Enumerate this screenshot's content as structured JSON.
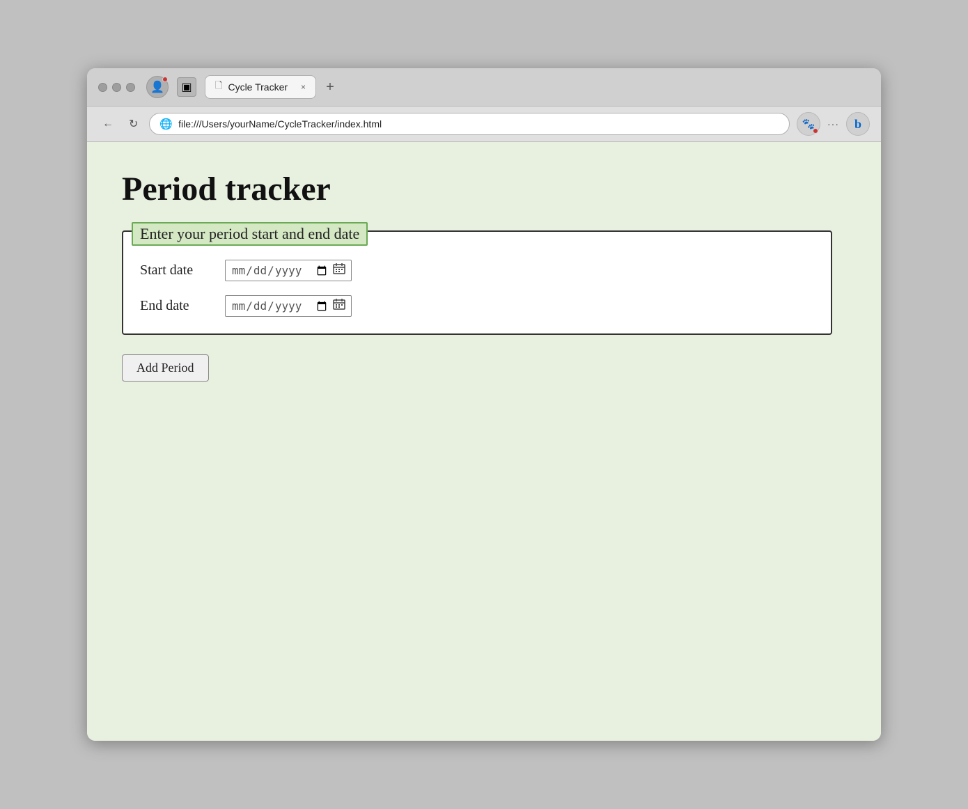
{
  "browser": {
    "tab_title": "Cycle Tracker",
    "tab_close_label": "×",
    "new_tab_label": "+",
    "address": "file:///Users/yourName/CycleTracker/index.html",
    "back_label": "←",
    "refresh_label": "↻"
  },
  "page": {
    "title": "Period tracker",
    "fieldset_legend": "Enter your period start and end date",
    "start_date_label": "Start date",
    "start_date_placeholder": "mm/dd/yyyy",
    "end_date_label": "End date",
    "end_date_placeholder": "mm/dd/yyyy",
    "add_button_label": "Add Period"
  }
}
